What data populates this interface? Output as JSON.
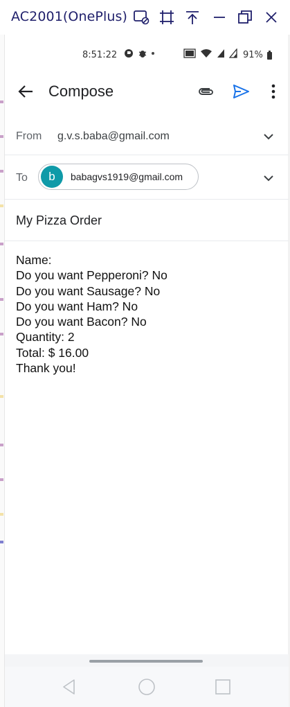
{
  "window": {
    "title": "AC2001(OnePlus)",
    "buttons": [
      "screen-cast-icon",
      "screenshot-icon",
      "pin-icon",
      "minimize-icon",
      "restore-icon",
      "close-icon"
    ]
  },
  "status_bar": {
    "time": "8:51:22",
    "battery": "91%"
  },
  "app_bar": {
    "title": "Compose"
  },
  "from": {
    "label": "From",
    "value": "g.v.s.baba@gmail.com"
  },
  "to": {
    "label": "To",
    "chip_initial": "b",
    "chip_email": "babagvs1919@gmail.com"
  },
  "subject": "My Pizza Order",
  "body": {
    "lines": [
      "Name:",
      "Do you want Pepperoni? No",
      "Do you want Sausage? No",
      "Do you want Ham? No",
      "Do you want Bacon? No",
      "Quantity: 2",
      "Total: $ 16.00",
      "Thank you!"
    ]
  },
  "colors": {
    "accent_send": "#1a73e8",
    "avatar": "#0f9aa8",
    "title_text": "#1f1f6b"
  }
}
